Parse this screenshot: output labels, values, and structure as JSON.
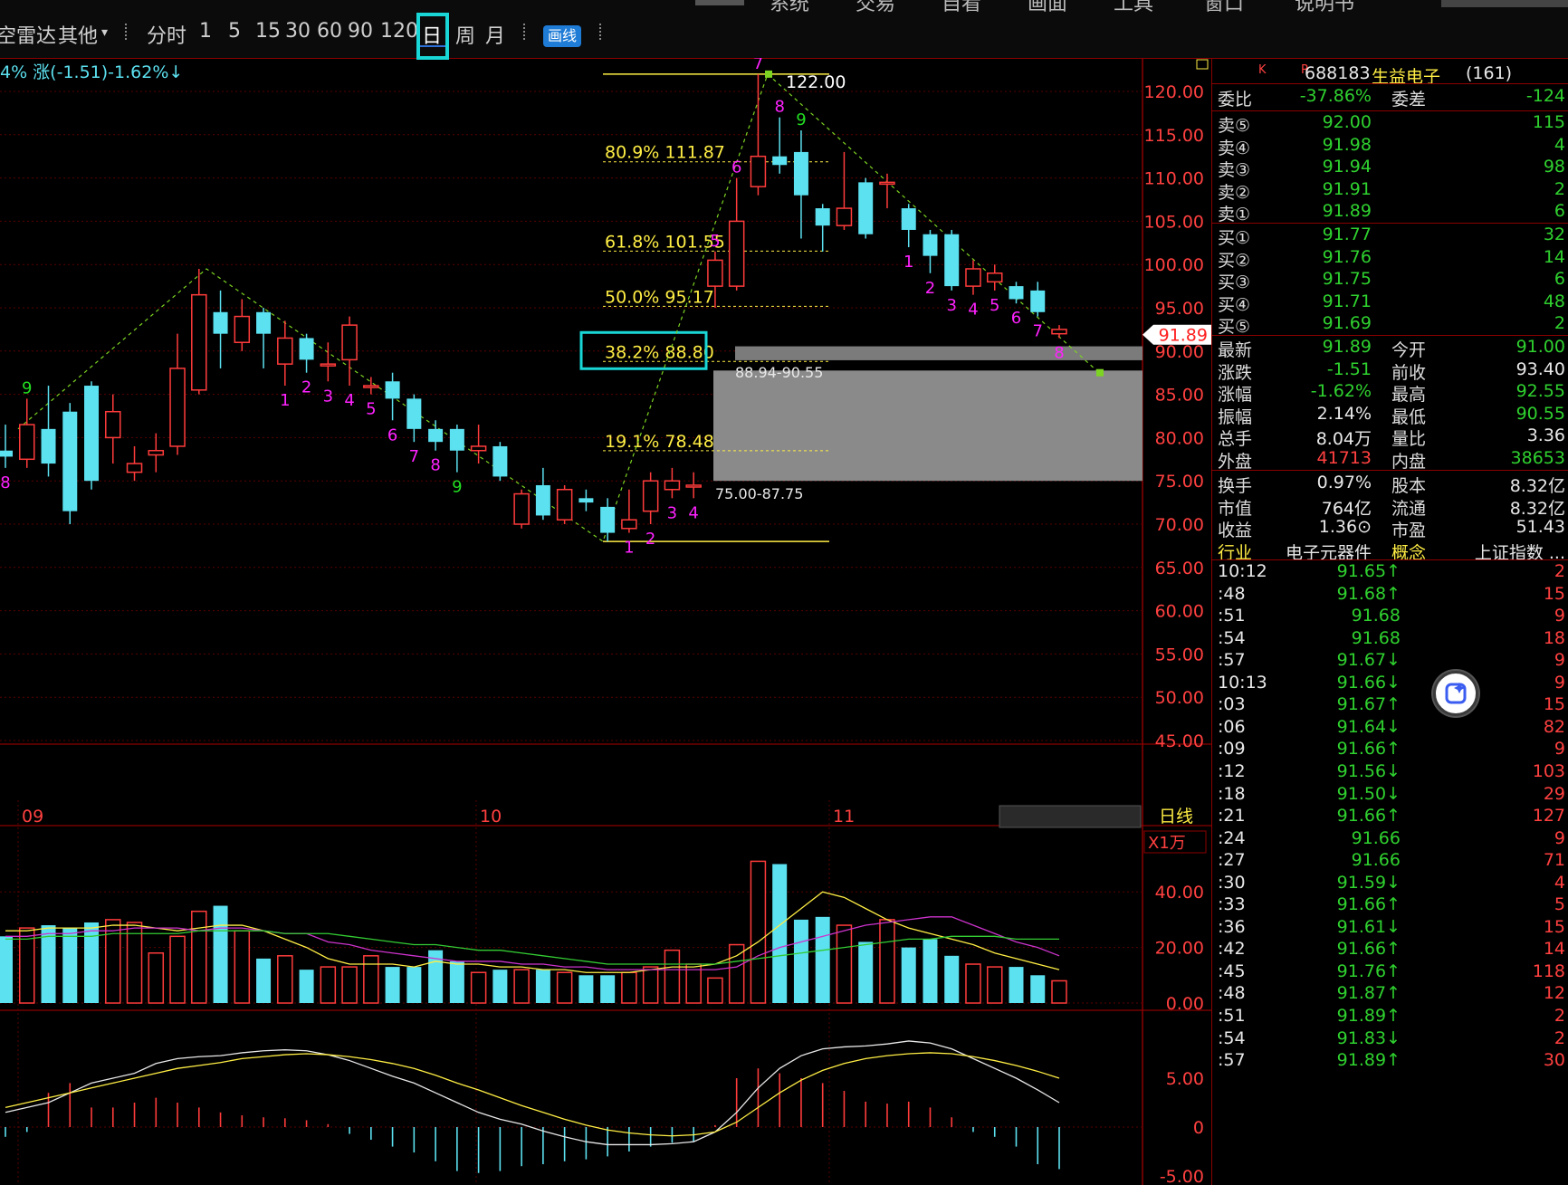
{
  "toolbar": {
    "left_cut": "空雷达",
    "other_label": "其他",
    "periods": [
      "分时",
      "1",
      "5",
      "15",
      "30",
      "60",
      "90",
      "120",
      "日",
      "周",
      "月"
    ],
    "selected_period": "日",
    "draw_label": "画线",
    "menus": [
      "系统",
      "交易",
      "自看",
      "画面",
      "工具",
      "窗口",
      "说明书"
    ]
  },
  "chart_info": {
    "change_text": "4%  涨(-1.51)-1.62%↓"
  },
  "chart_data": {
    "type": "candlestick",
    "price_axis": [
      "120.00",
      "115.00",
      "110.00",
      "105.00",
      "100.00",
      "95.00",
      "90.00",
      "85.00",
      "80.00",
      "75.00",
      "70.00",
      "65.00",
      "60.00",
      "55.00",
      "50.00",
      "45.00"
    ],
    "ylim": [
      45,
      125
    ],
    "month_labels": [
      "09",
      "10",
      "11"
    ],
    "period_label": "日线",
    "last_price_tag": "91.89",
    "fib_levels": [
      {
        "label": "80.9% 111.87",
        "price": 111.87
      },
      {
        "label": "61.8% 101.55",
        "price": 101.55
      },
      {
        "label": "50.0% 95.17",
        "price": 95.17
      },
      {
        "label": "38.2% 88.80",
        "price": 88.8
      },
      {
        "label": "19.1% 78.48",
        "price": 78.48
      }
    ],
    "high_marker": "122.00",
    "zones": [
      {
        "label": "88.94-90.55",
        "low": 88.94,
        "high": 90.55
      },
      {
        "label": "75.00-87.75",
        "low": 75.0,
        "high": 87.75
      }
    ],
    "candles": [
      {
        "o": 78.5,
        "c": 77.8,
        "h": 81.5,
        "l": 76.5,
        "seq": "8"
      },
      {
        "o": 77.5,
        "c": 81.5,
        "h": 84.5,
        "l": 76.5,
        "seq": "9"
      },
      {
        "o": 81.0,
        "c": 77.0,
        "h": 86.0,
        "l": 75.5,
        "seq": ""
      },
      {
        "o": 83.0,
        "c": 71.5,
        "h": 84.0,
        "l": 70.0,
        "seq": ""
      },
      {
        "o": 86.0,
        "c": 75.0,
        "h": 86.5,
        "l": 74.0,
        "seq": ""
      },
      {
        "o": 80.0,
        "c": 83.0,
        "h": 85.0,
        "l": 77.0,
        "seq": ""
      },
      {
        "o": 76.0,
        "c": 77.0,
        "h": 79.0,
        "l": 75.0,
        "seq": ""
      },
      {
        "o": 78.0,
        "c": 78.5,
        "h": 80.5,
        "l": 76.0,
        "seq": ""
      },
      {
        "o": 79.0,
        "c": 88.0,
        "h": 92.0,
        "l": 78.0,
        "seq": ""
      },
      {
        "o": 85.5,
        "c": 96.5,
        "h": 99.5,
        "l": 85.0,
        "seq": ""
      },
      {
        "o": 94.5,
        "c": 92.0,
        "h": 97.0,
        "l": 88.0,
        "seq": ""
      },
      {
        "o": 91.0,
        "c": 94.0,
        "h": 96.0,
        "l": 90.0,
        "seq": ""
      },
      {
        "o": 94.5,
        "c": 92.0,
        "h": 95.0,
        "l": 88.0,
        "seq": ""
      },
      {
        "o": 88.5,
        "c": 91.5,
        "h": 93.5,
        "l": 86.0,
        "seq": "1"
      },
      {
        "o": 91.5,
        "c": 89.0,
        "h": 92.0,
        "l": 87.5,
        "seq": "2"
      },
      {
        "o": 88.5,
        "c": 88.5,
        "h": 91.0,
        "l": 86.5,
        "seq": "3"
      },
      {
        "o": 89.0,
        "c": 93.0,
        "h": 94.0,
        "l": 86.0,
        "seq": "4"
      },
      {
        "o": 86.0,
        "c": 86.0,
        "h": 87.0,
        "l": 85.0,
        "seq": "5"
      },
      {
        "o": 86.5,
        "c": 84.5,
        "h": 87.5,
        "l": 82.0,
        "seq": "6"
      },
      {
        "o": 84.5,
        "c": 81.0,
        "h": 85.0,
        "l": 79.5,
        "seq": "7"
      },
      {
        "o": 81.0,
        "c": 79.5,
        "h": 82.0,
        "l": 78.5,
        "seq": "8"
      },
      {
        "o": 81.0,
        "c": 78.5,
        "h": 81.5,
        "l": 76.0,
        "seq": "9"
      },
      {
        "o": 78.5,
        "c": 79.0,
        "h": 81.5,
        "l": 77.0,
        "seq": ""
      },
      {
        "o": 79.0,
        "c": 75.5,
        "h": 79.5,
        "l": 75.0,
        "seq": ""
      },
      {
        "o": 70.0,
        "c": 73.5,
        "h": 74.0,
        "l": 69.5,
        "seq": ""
      },
      {
        "o": 74.5,
        "c": 71.0,
        "h": 76.5,
        "l": 70.5,
        "seq": ""
      },
      {
        "o": 70.5,
        "c": 74.0,
        "h": 74.5,
        "l": 70.0,
        "seq": ""
      },
      {
        "o": 73.0,
        "c": 72.5,
        "h": 74.0,
        "l": 71.5,
        "seq": ""
      },
      {
        "o": 72.0,
        "c": 69.0,
        "h": 73.0,
        "l": 68.0,
        "seq": ""
      },
      {
        "o": 69.5,
        "c": 70.5,
        "h": 74.0,
        "l": 69.0,
        "seq": "1"
      },
      {
        "o": 71.5,
        "c": 75.0,
        "h": 76.0,
        "l": 70.0,
        "seq": "2"
      },
      {
        "o": 74.0,
        "c": 75.0,
        "h": 76.5,
        "l": 73.0,
        "seq": "3"
      },
      {
        "o": 74.5,
        "c": 74.5,
        "h": 76.0,
        "l": 73.0,
        "seq": "4"
      },
      {
        "o": 97.5,
        "c": 100.5,
        "h": 101.5,
        "l": 95.0,
        "seq": "5"
      },
      {
        "o": 97.5,
        "c": 105.0,
        "h": 110.0,
        "l": 97.0,
        "seq": "6"
      },
      {
        "o": 109.0,
        "c": 112.5,
        "h": 122.0,
        "l": 108.0,
        "seq": "7"
      },
      {
        "o": 112.5,
        "c": 111.5,
        "h": 117.0,
        "l": 110.5,
        "seq": "8"
      },
      {
        "o": 113.0,
        "c": 108.0,
        "h": 115.5,
        "l": 103.0,
        "seq": "9"
      },
      {
        "o": 106.5,
        "c": 104.5,
        "h": 107.0,
        "l": 101.5,
        "seq": ""
      },
      {
        "o": 104.5,
        "c": 106.5,
        "h": 113.0,
        "l": 104.0,
        "seq": ""
      },
      {
        "o": 109.5,
        "c": 103.5,
        "h": 110.0,
        "l": 103.0,
        "seq": ""
      },
      {
        "o": 109.5,
        "c": 109.5,
        "h": 110.5,
        "l": 106.5,
        "seq": ""
      },
      {
        "o": 106.5,
        "c": 104.0,
        "h": 107.0,
        "l": 102.0,
        "seq": "1"
      },
      {
        "o": 103.5,
        "c": 101.0,
        "h": 104.0,
        "l": 99.0,
        "seq": "2"
      },
      {
        "o": 103.5,
        "c": 97.5,
        "h": 104.0,
        "l": 97.0,
        "seq": "3"
      },
      {
        "o": 97.5,
        "c": 99.5,
        "h": 100.5,
        "l": 96.5,
        "seq": "4"
      },
      {
        "o": 98.0,
        "c": 99.0,
        "h": 100.0,
        "l": 97.0,
        "seq": "5"
      },
      {
        "o": 97.5,
        "c": 96.0,
        "h": 98.0,
        "l": 95.5,
        "seq": "6"
      },
      {
        "o": 97.0,
        "c": 94.5,
        "h": 98.0,
        "l": 94.0,
        "seq": "7"
      },
      {
        "o": 92.0,
        "c": 92.5,
        "h": 93.0,
        "l": 91.5,
        "seq": "8"
      }
    ],
    "volume_axis": [
      "40.00",
      "20.00",
      "0.00"
    ],
    "volume_unit": "X1万",
    "volumes": [
      24,
      27,
      28,
      27,
      29,
      30,
      29,
      18,
      24,
      33,
      35,
      26,
      16,
      17,
      12,
      13,
      13,
      17,
      13,
      13,
      19,
      15,
      11,
      12,
      12,
      12,
      11,
      10,
      10,
      11,
      13,
      19,
      14,
      9,
      21,
      51,
      50,
      30,
      31,
      28,
      22,
      30,
      20,
      23,
      17,
      14,
      13,
      13,
      10,
      8
    ],
    "volume_ma": [
      {
        "name": "MA5",
        "color": "#ffee44",
        "values": [
          26,
          26,
          27,
          27,
          27,
          28,
          28,
          27,
          26,
          27,
          28,
          28,
          26,
          23,
          20,
          16,
          14,
          14,
          14,
          13,
          15,
          14,
          14,
          13,
          13,
          12,
          12,
          11,
          11,
          11,
          12,
          13,
          13,
          14,
          17,
          22,
          28,
          34,
          40,
          38,
          34,
          30,
          27,
          25,
          23,
          21,
          18,
          16,
          14,
          12
        ]
      },
      {
        "name": "MA10",
        "color": "#cc33cc",
        "values": [
          24,
          24,
          25,
          25,
          26,
          26,
          27,
          27,
          27,
          26,
          27,
          27,
          26,
          25,
          25,
          22,
          21,
          19,
          18,
          17,
          16,
          15,
          15,
          15,
          14,
          14,
          13,
          13,
          12,
          12,
          12,
          12,
          12,
          12,
          13,
          17,
          20,
          22,
          24,
          26,
          28,
          29,
          30,
          31,
          31,
          28,
          25,
          22,
          20,
          17
        ]
      },
      {
        "name": "MA20",
        "color": "#33cc33",
        "values": [
          23,
          23,
          24,
          24,
          24,
          25,
          25,
          25,
          25,
          26,
          26,
          26,
          26,
          25,
          25,
          25,
          24,
          23,
          22,
          21,
          21,
          20,
          19,
          19,
          18,
          17,
          16,
          15,
          14,
          14,
          14,
          14,
          14,
          14,
          15,
          16,
          17,
          18,
          19,
          20,
          21,
          22,
          23,
          23,
          24,
          24,
          24,
          23,
          23,
          23
        ]
      }
    ],
    "macd_axis": [
      "5.00",
      "0",
      "-5.00"
    ],
    "macd_dif": [
      1.5,
      2,
      2.5,
      3.5,
      4.5,
      5,
      5.5,
      6.5,
      7,
      7.2,
      7.3,
      7.6,
      7.8,
      7.9,
      7.8,
      7.4,
      6.8,
      6,
      5.2,
      4.5,
      3.5,
      2.5,
      1.5,
      0.8,
      0.3,
      -0.4,
      -1,
      -1.5,
      -1.8,
      -1.8,
      -1.8,
      -1.7,
      -1.5,
      -0.5,
      1.5,
      4,
      6,
      7.3,
      8,
      8.2,
      8.3,
      8.5,
      8.8,
      8.6,
      8,
      7,
      6,
      5,
      3.8,
      2.5
    ],
    "macd_dea": [
      2,
      2.5,
      3,
      3.5,
      4,
      4.5,
      5,
      5.5,
      6,
      6.3,
      6.6,
      7,
      7.2,
      7.4,
      7.5,
      7.4,
      7.2,
      6.9,
      6.5,
      6,
      5.3,
      4.5,
      3.8,
      3,
      2.2,
      1.5,
      0.8,
      0.2,
      -0.3,
      -0.6,
      -0.8,
      -0.9,
      -0.8,
      -0.5,
      0.5,
      2,
      3.5,
      4.8,
      5.8,
      6.5,
      7,
      7.3,
      7.5,
      7.6,
      7.5,
      7.2,
      6.8,
      6.3,
      5.7,
      5
    ],
    "macd_hist": [
      -1,
      -0.5,
      3.5,
      4.5,
      2,
      2,
      2.5,
      3,
      2.5,
      2,
      1.5,
      1.2,
      1,
      0.9,
      0.7,
      0.3,
      -0.7,
      -1.3,
      -2,
      -2.6,
      -3.5,
      -4.5,
      -4.7,
      -4.5,
      -4,
      -3.8,
      -3.5,
      -3.3,
      -3,
      -2.5,
      -2,
      -1.6,
      -1.5,
      0.2,
      5,
      6,
      5.5,
      5,
      4.5,
      3.7,
      2.6,
      2.4,
      2.6,
      2,
      1,
      -0.5,
      -1,
      -2,
      -3.8,
      -4.3
    ]
  },
  "quote": {
    "header": {
      "k_label": "K",
      "r_label": "R",
      "code": "688183",
      "name": "生益电子",
      "id": "(161)"
    },
    "weibi": {
      "label": "委比",
      "value": "-37.86%",
      "label2": "委差",
      "value2": "-124"
    },
    "asks": [
      {
        "label": "卖⑤",
        "price": "92.00",
        "vol": "115"
      },
      {
        "label": "卖④",
        "price": "91.98",
        "vol": "4"
      },
      {
        "label": "卖③",
        "price": "91.94",
        "vol": "98"
      },
      {
        "label": "卖②",
        "price": "91.91",
        "vol": "2"
      },
      {
        "label": "卖①",
        "price": "91.89",
        "vol": "6"
      }
    ],
    "bids": [
      {
        "label": "买①",
        "price": "91.77",
        "vol": "32"
      },
      {
        "label": "买②",
        "price": "91.76",
        "vol": "14"
      },
      {
        "label": "买③",
        "price": "91.75",
        "vol": "6"
      },
      {
        "label": "买④",
        "price": "91.71",
        "vol": "48"
      },
      {
        "label": "买⑤",
        "price": "91.69",
        "vol": "2"
      }
    ],
    "stats": [
      {
        "l1": "最新",
        "v1": "91.89",
        "l2": "今开",
        "v2": "91.00",
        "c1": "grn",
        "c2": "grn"
      },
      {
        "l1": "涨跌",
        "v1": "-1.51",
        "l2": "前收",
        "v2": "93.40",
        "c1": "grn",
        "c2": "wht"
      },
      {
        "l1": "涨幅",
        "v1": "-1.62%",
        "l2": "最高",
        "v2": "92.55",
        "c1": "grn",
        "c2": "grn"
      },
      {
        "l1": "振幅",
        "v1": "2.14%",
        "l2": "最低",
        "v2": "90.55",
        "c1": "wht",
        "c2": "grn"
      },
      {
        "l1": "总手",
        "v1": "8.04万",
        "l2": "量比",
        "v2": "3.36",
        "c1": "wht",
        "c2": "wht"
      },
      {
        "l1": "外盘",
        "v1": "41713",
        "l2": "内盘",
        "v2": "38653",
        "c1": "red",
        "c2": "grn"
      }
    ],
    "info": [
      {
        "l1": "换手",
        "v1": "0.97%",
        "l2": "股本",
        "v2": "8.32亿"
      },
      {
        "l1": "市值",
        "v1": "764亿",
        "l2": "流通",
        "v2": "8.32亿"
      },
      {
        "l1": "收益",
        "v1": "1.36⊙",
        "l2": "市盈",
        "v2": "51.43"
      },
      {
        "l1": "行业",
        "v1": "电子元器件",
        "l2": "概念",
        "v2": "上证指数 ..."
      }
    ],
    "ticks": [
      {
        "t": "10:12",
        "p": "91.65↑",
        "v": "2",
        "dir": "up"
      },
      {
        "t": ":48",
        "p": "91.68↑",
        "v": "15",
        "dir": "up"
      },
      {
        "t": ":51",
        "p": "91.68",
        "v": "9",
        "dir": "up"
      },
      {
        "t": ":54",
        "p": "91.68",
        "v": "18",
        "dir": "up"
      },
      {
        "t": ":57",
        "p": "91.67↓",
        "v": "9",
        "dir": "dn"
      },
      {
        "t": "10:13",
        "p": "91.66↓",
        "v": "9",
        "dir": "dn"
      },
      {
        "t": ":03",
        "p": "91.67↑",
        "v": "15",
        "dir": "up"
      },
      {
        "t": ":06",
        "p": "91.64↓",
        "v": "82",
        "dir": "dn"
      },
      {
        "t": ":09",
        "p": "91.66↑",
        "v": "9",
        "dir": "up"
      },
      {
        "t": ":12",
        "p": "91.56↓",
        "v": "103",
        "dir": "dn"
      },
      {
        "t": ":18",
        "p": "91.50↓",
        "v": "29",
        "dir": "dn"
      },
      {
        "t": ":21",
        "p": "91.66↑",
        "v": "127",
        "dir": "up"
      },
      {
        "t": ":24",
        "p": "91.66",
        "v": "9",
        "dir": "up"
      },
      {
        "t": ":27",
        "p": "91.66",
        "v": "71",
        "dir": "up"
      },
      {
        "t": ":30",
        "p": "91.59↓",
        "v": "4",
        "dir": "dn"
      },
      {
        "t": ":33",
        "p": "91.66↑",
        "v": "5",
        "dir": "up"
      },
      {
        "t": ":36",
        "p": "91.61↓",
        "v": "15",
        "dir": "dn"
      },
      {
        "t": ":42",
        "p": "91.66↑",
        "v": "14",
        "dir": "up"
      },
      {
        "t": ":45",
        "p": "91.76↑",
        "v": "118",
        "dir": "up"
      },
      {
        "t": ":48",
        "p": "91.87↑",
        "v": "12",
        "dir": "up"
      },
      {
        "t": ":51",
        "p": "91.89↑",
        "v": "2",
        "dir": "up"
      },
      {
        "t": ":54",
        "p": "91.83↓",
        "v": "2",
        "dir": "dn"
      },
      {
        "t": ":57",
        "p": "91.89↑",
        "v": "30",
        "dir": "up"
      }
    ]
  }
}
